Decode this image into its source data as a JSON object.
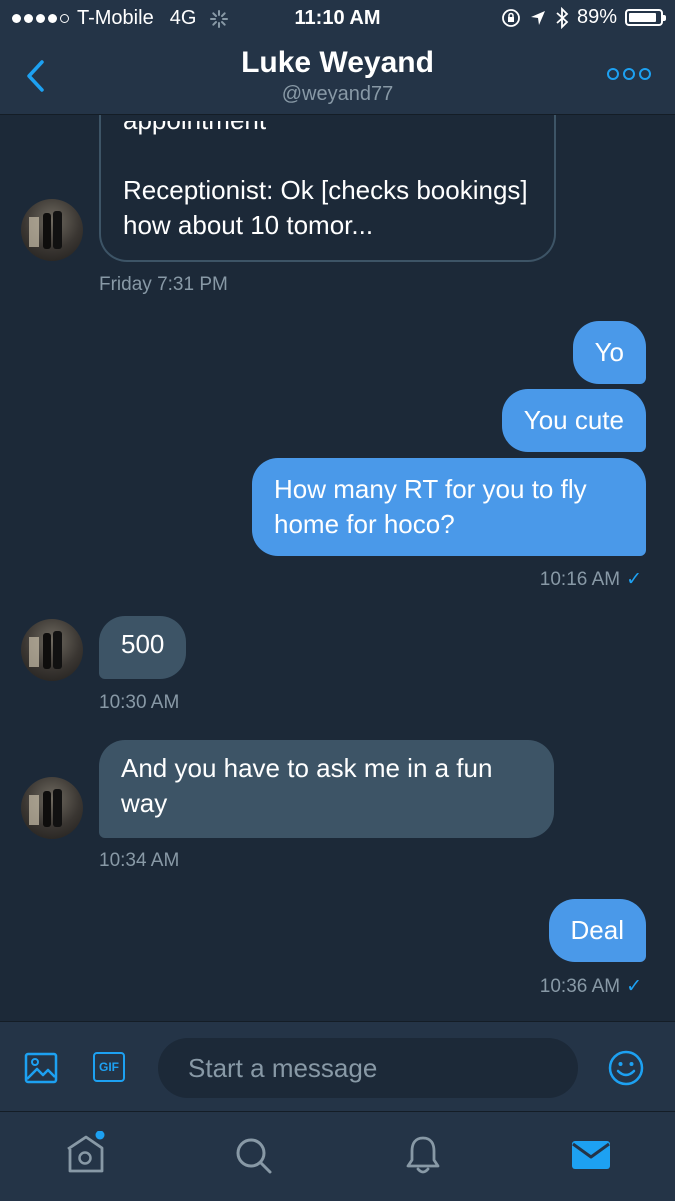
{
  "status_bar": {
    "carrier": "T-Mobile",
    "network": "4G",
    "time": "11:10 AM",
    "battery": "89%",
    "battery_level": 0.89
  },
  "header": {
    "name": "Luke Weyand",
    "handle": "@weyand77"
  },
  "card": {
    "preview_partial": "appointment",
    "text": "Receptionist: Ok [checks bookings] how about 10 tomor..."
  },
  "messages": {
    "card_time": "Friday 7:31 PM",
    "out1": "Yo",
    "out2": "You cute",
    "out3": "How many RT for you to fly home for hoco?",
    "out3_time": "10:16 AM",
    "in1": "500",
    "in1_time": "10:30 AM",
    "in2": "And you have to ask me in a fun way",
    "in2_time": "10:34 AM",
    "out4": "Deal",
    "out4_time": "10:36 AM",
    "read_mark": "✓"
  },
  "composer": {
    "gif_label": "GIF",
    "placeholder": "Start a message"
  },
  "colors": {
    "accent": "#1da1f2",
    "background": "#1c2938",
    "bar": "#243447",
    "incoming_bubble": "#3d5466",
    "outgoing_bubble": "#4a99e9"
  },
  "icons": {
    "header": [
      "back-chevron-icon",
      "more-icon"
    ],
    "composer": [
      "image-icon",
      "gif-icon",
      "emoji-icon"
    ],
    "tabs": [
      "home-icon",
      "search-icon",
      "notifications-icon",
      "messages-icon"
    ]
  }
}
